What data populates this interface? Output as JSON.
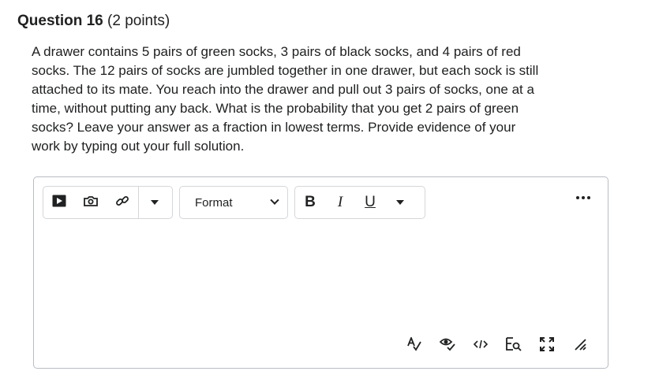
{
  "question": {
    "title": "Question 16",
    "points": "(2 points)",
    "lines": [
      "A drawer contains 5 pairs of green socks, 3 pairs of black socks, and 4 pairs of red",
      "socks. The 12 pairs of socks are jumbled together in one drawer, but each sock is still",
      "attached to its mate. You reach into the drawer and pull out 3 pairs of socks, one at a",
      "time, without putting any back. What is the probability that you get 2 pairs of green",
      "socks? Leave your answer as a fraction in lowest terms. Provide evidence of your",
      "work by typing out your full solution."
    ]
  },
  "toolbar": {
    "insert_icons": [
      "insert-stuff-icon",
      "insert-image-icon",
      "insert-link-icon"
    ],
    "format_select": {
      "selected": "Format"
    },
    "text_styles": {
      "bold": "B",
      "italic": "I",
      "underline": "U"
    },
    "more_icon": "ellipsis-icon"
  },
  "status_bar": {
    "icons": [
      "spellcheck-icon",
      "accessibility-checker-icon",
      "source-code-icon",
      "preview-icon",
      "fullscreen-icon",
      "resize-handle-icon"
    ]
  }
}
